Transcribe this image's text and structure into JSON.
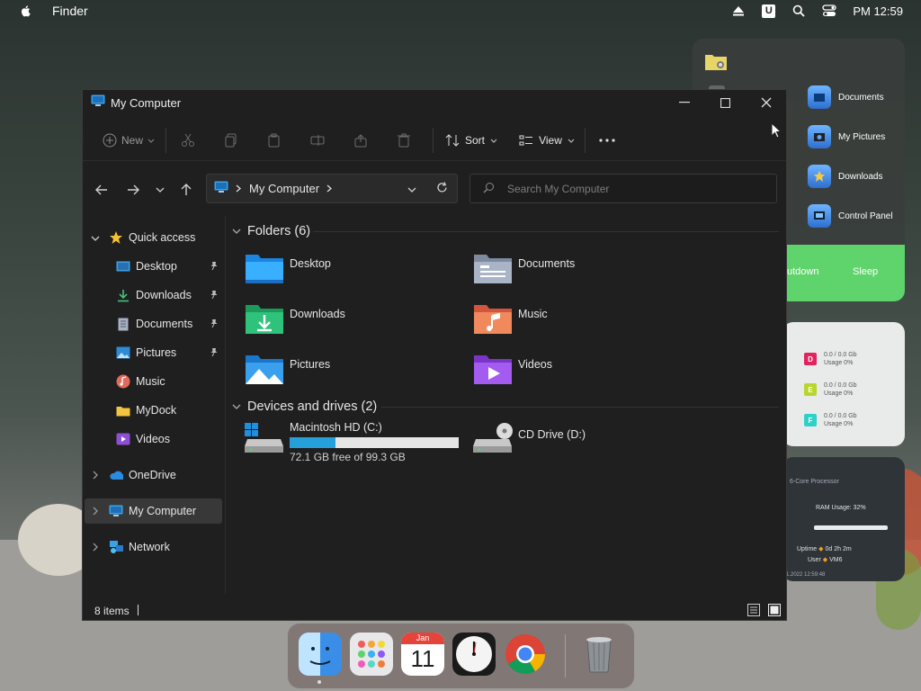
{
  "menubar": {
    "app_name": "Finder",
    "clock": "PM 12:59",
    "icons": [
      "apple-icon",
      "eject-icon",
      "u-icon",
      "search-icon",
      "control-center-icon"
    ],
    "u_label": "U"
  },
  "right_panel": {
    "items": [
      "Documents",
      "My Pictures",
      "Downloads",
      "Control Panel"
    ],
    "power": {
      "shutdown": "utdown",
      "sleep": "Sleep"
    }
  },
  "usage_widget": {
    "drives": [
      {
        "letter": "D",
        "line1": "0.0 / 0.0 Gb",
        "line2": "Usage 0%",
        "color": "#e0245e"
      },
      {
        "letter": "E",
        "line1": "0.0 / 0.0 Gb",
        "line2": "Usage 0%",
        "color": "#b6d62e"
      },
      {
        "letter": "F",
        "line1": "0.0 / 0.0 Gb",
        "line2": "Usage 0%",
        "color": "#2ed1c8"
      }
    ]
  },
  "sys_widget": {
    "processor": "6-Core Processor",
    "ram": "RAM Usage: 32%",
    "ram_usage": 0.32,
    "uptime_label": "Uptime",
    "uptime": "0d 2h 2m",
    "user_label": "User",
    "user": "VM6",
    "datetime": "1.2022 12:59:48"
  },
  "window": {
    "title": "My Computer",
    "toolbar": {
      "new": "New",
      "sort": "Sort",
      "view": "View"
    },
    "address": "My Computer",
    "search_placeholder": "Search My Computer",
    "sidebar": {
      "quick_access": "Quick access",
      "items": [
        {
          "label": "Desktop",
          "pinned": true
        },
        {
          "label": "Downloads",
          "pinned": true
        },
        {
          "label": "Documents",
          "pinned": true
        },
        {
          "label": "Pictures",
          "pinned": true
        },
        {
          "label": "Music",
          "pinned": false
        },
        {
          "label": "MyDock",
          "pinned": false
        },
        {
          "label": "Videos",
          "pinned": false
        }
      ],
      "onedrive": "OneDrive",
      "my_computer": "My Computer",
      "network": "Network"
    },
    "folders_header": "Folders (6)",
    "folders": [
      "Desktop",
      "Documents",
      "Downloads",
      "Music",
      "Pictures",
      "Videos"
    ],
    "drives_header": "Devices and drives (2)",
    "drives": [
      {
        "name": "Macintosh HD (C:)",
        "free": "72.1 GB free of 99.3 GB",
        "used_fraction": 0.27
      },
      {
        "name": "CD Drive (D:)"
      }
    ],
    "status": "8 items"
  },
  "dock": {
    "apps": [
      "finder",
      "launchpad",
      "calendar",
      "clock",
      "chrome",
      "trash"
    ],
    "calendar_month": "Jan",
    "calendar_day": "11"
  }
}
